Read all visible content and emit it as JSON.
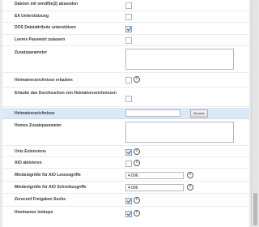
{
  "settings": [
    {
      "label": "Dateien mit sendfile(2) absenden",
      "control": "checkbox",
      "checked": false
    },
    {
      "label": "EA Unterstützung",
      "control": "checkbox",
      "checked": false
    },
    {
      "label": "DOS Dateiattribute unterstützen",
      "control": "checkbox",
      "checked": true
    },
    {
      "label": "Leeres Passwort zulassen",
      "control": "checkbox",
      "checked": false
    },
    {
      "label": "Zusatzparameter",
      "control": "textarea",
      "value": ""
    },
    {
      "label": "Heimatverzeichnisse erlauben",
      "control": "checkbox",
      "checked": false,
      "info": true
    },
    {
      "label": "Erlaube das Durchsuchen von Heimatverzeichnissen",
      "control": "checkbox",
      "checked": false
    },
    {
      "label": "Heimatverzeichnisse",
      "control": "text-browse",
      "value": "",
      "button": "Browse"
    },
    {
      "label": "Homes Zusatzparameter",
      "control": "textarea",
      "value": ""
    },
    {
      "label": "Unix Extensions",
      "control": "checkbox",
      "checked": true,
      "info": true
    },
    {
      "label": "AIO aktivieren",
      "control": "checkbox",
      "checked": false,
      "info": true
    },
    {
      "label": "Mindestgröße für AIO Lesezugriffe",
      "control": "text",
      "value": "4.096",
      "info": true
    },
    {
      "label": "Mindestgröße für AIO Schreibzugriffe",
      "control": "text",
      "value": "4.096",
      "info": true
    },
    {
      "label": "Zeroconf Freigaben Suche",
      "control": "checkbox",
      "checked": true,
      "info": true
    },
    {
      "label": "Hostnames lookups",
      "control": "checkbox",
      "checked": true,
      "info": true
    }
  ],
  "colors": {
    "highlight_row": "#dbe8f7",
    "panel": "#ffffff",
    "background": "#e9e9e9"
  }
}
